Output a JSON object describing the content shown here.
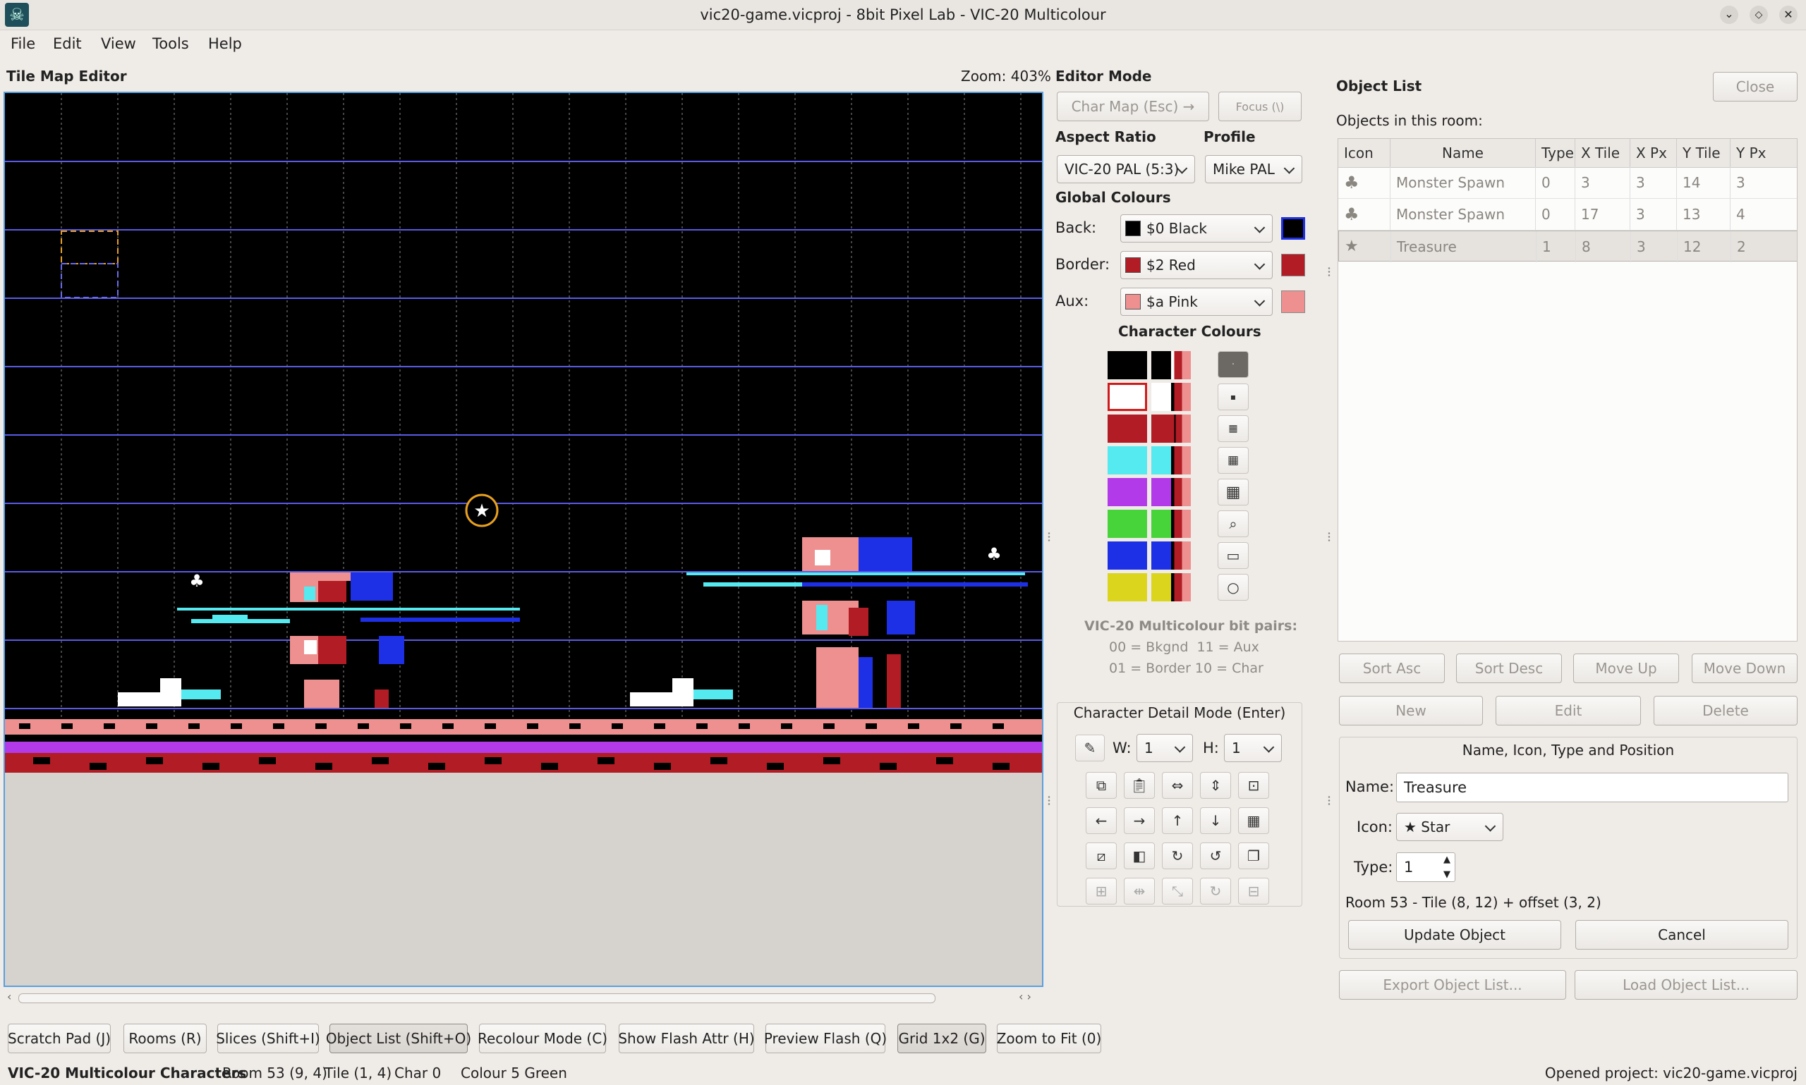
{
  "window": {
    "title": "vic20-game.vicproj - 8bit Pixel Lab - VIC-20 Multicolour"
  },
  "menu": [
    "File",
    "Edit",
    "View",
    "Tools",
    "Help"
  ],
  "tilemap": {
    "title": "Tile Map Editor",
    "zoom_label": "Zoom: 403%"
  },
  "editor_mode": {
    "title": "Editor Mode",
    "char_map_button": "Char Map (Esc) →",
    "focus_button": "Focus (\\)",
    "aspect_label": "Aspect Ratio",
    "aspect_value": "VIC-20 PAL (5:3)",
    "profile_label": "Profile",
    "profile_value": "Mike PAL",
    "global_colours_title": "Global Colours",
    "back_label": "Back:",
    "back_value": "$0 Black",
    "back_colour": "#000000",
    "border_label": "Border:",
    "border_value": "$2 Red",
    "border_colour": "#b21c24",
    "aux_label": "Aux:",
    "aux_value": "$a Pink",
    "aux_colour": "#ee9090",
    "char_colours_title": "Character Colours",
    "char_colours": [
      "#000000",
      "#ffffff",
      "#b21c24",
      "#55e9f0",
      "#b33ae9",
      "#47d43a",
      "#1e30e6",
      "#dcd51e"
    ],
    "bitpairs_title": "VIC-20 Multicolour bit pairs:",
    "bitpairs_line1": "00 = Bkgnd  11 = Aux",
    "bitpairs_line2": "01 = Border 10 = Char"
  },
  "char_detail": {
    "title": "Character Detail Mode (Enter)",
    "w_label": "W:",
    "w_value": "1",
    "h_label": "H:",
    "h_value": "1"
  },
  "object_list": {
    "title": "Object List",
    "close_button": "Close",
    "subtitle": "Objects in this room:",
    "columns": [
      "Icon",
      "Name",
      "Type",
      "X Tile",
      "X Px",
      "Y Tile",
      "Y Px"
    ],
    "rows": [
      {
        "icon": "♣",
        "name": "Monster Spawn",
        "type": "0",
        "x_tile": "3",
        "x_px": "3",
        "y_tile": "14",
        "y_px": "3"
      },
      {
        "icon": "♣",
        "name": "Monster Spawn",
        "type": "0",
        "x_tile": "17",
        "x_px": "3",
        "y_tile": "13",
        "y_px": "4"
      },
      {
        "icon": "★",
        "name": "Treasure",
        "type": "1",
        "x_tile": "8",
        "x_px": "3",
        "y_tile": "12",
        "y_px": "2"
      }
    ],
    "sort_asc": "Sort Asc",
    "sort_desc": "Sort Desc",
    "move_up": "Move Up",
    "move_down": "Move Down",
    "new": "New",
    "edit": "Edit",
    "delete": "Delete",
    "group_title": "Name, Icon, Type and Position",
    "name_label": "Name:",
    "name_value": "Treasure",
    "icon_label": "Icon:",
    "icon_value": "★ Star",
    "type_label": "Type:",
    "type_value": "1",
    "position_text": "Room 53 - Tile (8, 12) + offset (3, 2)",
    "update_button": "Update Object",
    "cancel_button": "Cancel",
    "export_button": "Export Object List...",
    "load_button": "Load Object List..."
  },
  "bottom_toolbar": [
    "Scratch Pad (J)",
    "Rooms (R)",
    "Slices (Shift+I)",
    "Object List (Shift+O)",
    "Recolour Mode (C)",
    "Show Flash Attr (H)",
    "Preview Flash (Q)",
    "Grid 1x2 (G)",
    "Zoom to Fit (0)"
  ],
  "status": {
    "mode": "VIC-20 Multicolour Characters",
    "room": "Room 53 (9, 4)",
    "tile": "Tile (1, 4)",
    "char": "Char 0",
    "colour": "Colour 5 Green",
    "message": "Opened project: vic20-game.vicproj"
  }
}
